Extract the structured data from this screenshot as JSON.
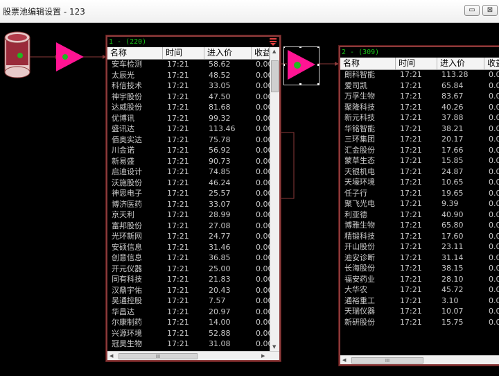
{
  "window": {
    "title": "股票池编辑设置 - 123",
    "minimize_label": "▭",
    "close_label": "⊠"
  },
  "colors": {
    "node_fill": "#ff1493",
    "node_glyph": "#1fb81f",
    "panel_border": "#8b3a3a",
    "connector": "#8b3a3a",
    "header_text": "#19c219"
  },
  "nodes": {
    "source_icon": "database-cylinder-icon",
    "filter1_icon": "triangle-filter-icon",
    "filter2_icon": "triangle-filter-icon"
  },
  "panel1": {
    "header": "1 -  (220)",
    "columns": [
      "名称",
      "时间",
      "进入价",
      "收益"
    ],
    "rows": [
      [
        "安车检测",
        "17:21",
        "58.62",
        "0.00"
      ],
      [
        "太辰光",
        "17:21",
        "48.52",
        "0.00"
      ],
      [
        "科信技术",
        "17:21",
        "33.05",
        "0.00"
      ],
      [
        "神宇股份",
        "17:21",
        "47.50",
        "0.00"
      ],
      [
        "达威股份",
        "17:21",
        "81.68",
        "0.00"
      ],
      [
        "优博讯",
        "17:21",
        "99.32",
        "0.00"
      ],
      [
        "盛讯达",
        "17:21",
        "113.46",
        "0.00"
      ],
      [
        "佰奥实达",
        "17:21",
        "75.78",
        "0.00"
      ],
      [
        "川金诺",
        "17:21",
        "56.92",
        "0.00"
      ],
      [
        "新易盛",
        "17:21",
        "90.73",
        "0.00"
      ],
      [
        "启迪设计",
        "17:21",
        "74.85",
        "0.00"
      ],
      [
        "沃施股份",
        "17:21",
        "46.24",
        "0.00"
      ],
      [
        "神思电子",
        "17:21",
        "25.57",
        "0.00"
      ],
      [
        "博济医药",
        "17:21",
        "33.07",
        "0.00"
      ],
      [
        "京天利",
        "17:21",
        "28.99",
        "0.00"
      ],
      [
        "富邦股份",
        "17:21",
        "27.08",
        "0.00"
      ],
      [
        "光环新网",
        "17:21",
        "24.77",
        "0.00"
      ],
      [
        "安硕信息",
        "17:21",
        "31.46",
        "0.00"
      ],
      [
        "创意信息",
        "17:21",
        "36.85",
        "0.00"
      ],
      [
        "开元仪器",
        "17:21",
        "25.00",
        "0.00"
      ],
      [
        "同有科技",
        "17:21",
        "21.83",
        "0.00"
      ],
      [
        "汉鼎宇佑",
        "17:21",
        "20.43",
        "0.00"
      ],
      [
        "吴通控股",
        "17:21",
        "7.57",
        "0.00"
      ],
      [
        "华昌达",
        "17:21",
        "20.97",
        "0.00"
      ],
      [
        "尔康制药",
        "17:21",
        "14.00",
        "0.00"
      ],
      [
        "兴源环境",
        "17:21",
        "52.88",
        "0.00"
      ],
      [
        "冠昊生物",
        "17:21",
        "31.08",
        "0.00"
      ]
    ],
    "hscroll_thumb": "III"
  },
  "panel2": {
    "header": "2 -  (309)",
    "columns": [
      "名称",
      "时间",
      "进入价",
      "收益"
    ],
    "rows": [
      [
        "朗科智能",
        "17:21",
        "113.28",
        "0.0"
      ],
      [
        "爱司凯",
        "17:21",
        "65.84",
        "0.0"
      ],
      [
        "万孚生物",
        "17:21",
        "83.67",
        "0.0"
      ],
      [
        "聚隆科技",
        "17:21",
        "40.26",
        "0.0"
      ],
      [
        "新元科技",
        "17:21",
        "37.88",
        "0.0"
      ],
      [
        "华铭智能",
        "17:21",
        "38.21",
        "0.0"
      ],
      [
        "三环集团",
        "17:21",
        "20.17",
        "0.0"
      ],
      [
        "汇金股份",
        "17:21",
        "17.66",
        "0.0"
      ],
      [
        "蒙草生态",
        "17:21",
        "15.85",
        "0.0"
      ],
      [
        "天银机电",
        "17:21",
        "24.87",
        "0.0"
      ],
      [
        "天壕环境",
        "17:21",
        "10.65",
        "0.0"
      ],
      [
        "任子行",
        "17:21",
        "19.65",
        "0.0"
      ],
      [
        "聚飞光电",
        "17:21",
        "9.39",
        "0.0"
      ],
      [
        "利亚德",
        "17:21",
        "40.90",
        "0.0"
      ],
      [
        "博雅生物",
        "17:21",
        "65.80",
        "0.0"
      ],
      [
        "精锻科技",
        "17:21",
        "17.60",
        "0.0"
      ],
      [
        "开山股份",
        "17:21",
        "23.11",
        "0.0"
      ],
      [
        "迪安诊断",
        "17:21",
        "31.14",
        "0.0"
      ],
      [
        "长海股份",
        "17:21",
        "38.15",
        "0.0"
      ],
      [
        "福安药业",
        "17:21",
        "28.10",
        "0.0"
      ],
      [
        "大华农",
        "17:21",
        "45.72",
        "0.0"
      ],
      [
        "通裕重工",
        "17:21",
        "3.10",
        "0.0"
      ],
      [
        "天瑞仪器",
        "17:21",
        "10.07",
        "0.0"
      ],
      [
        "新研股份",
        "17:21",
        "15.75",
        "0.0"
      ]
    ],
    "hscroll_thumb": "III"
  }
}
